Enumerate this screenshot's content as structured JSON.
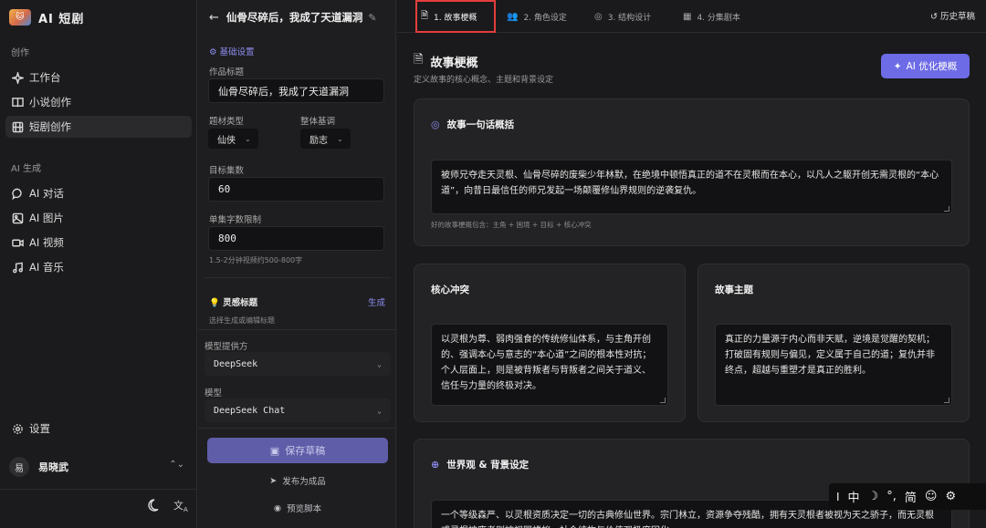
{
  "brand": {
    "logo_text": "🐱",
    "title": "AI 短剧"
  },
  "sidebar": {
    "section_create": "创作",
    "items_create": [
      {
        "label": "工作台",
        "icon": "sparkle-icon"
      },
      {
        "label": "小说创作",
        "icon": "book-icon"
      },
      {
        "label": "短剧创作",
        "icon": "film-icon",
        "active": true
      }
    ],
    "section_ai": "AI 生成",
    "items_ai": [
      {
        "label": "AI 对话",
        "icon": "chat-icon"
      },
      {
        "label": "AI 图片",
        "icon": "image-icon"
      },
      {
        "label": "AI 视频",
        "icon": "video-icon"
      },
      {
        "label": "AI 音乐",
        "icon": "music-icon"
      }
    ],
    "settings_label": "设置",
    "user": {
      "avatar_text": "易",
      "name": "易晓武"
    }
  },
  "panel": {
    "work_title": "仙骨尽碎后，我成了天道漏洞",
    "basic_settings": "基础设置",
    "title_label": "作品标题",
    "title_value": "仙骨尽碎后，我成了天道漏洞",
    "genre_label": "题材类型",
    "genre_value": "仙侠",
    "tone_label": "整体基调",
    "tone_value": "励志",
    "episodes_label": "目标集数",
    "episodes_value": "60",
    "wordlimit_label": "单集字数限制",
    "wordlimit_value": "800",
    "wordlimit_hint": "1.5-2分钟视频约500-800字",
    "inspire_label": "灵感标题",
    "inspire_action": "生成",
    "inspire_hint": "选择生成或编辑标题",
    "provider_label": "模型提供方",
    "provider_value": "DeepSeek",
    "model_label": "模型",
    "model_value": "DeepSeek Chat",
    "save_label": "保存草稿",
    "publish_label": "发布为成品",
    "preview_label": "预览脚本"
  },
  "tabs": [
    {
      "label": "1. 故事梗概",
      "icon": "doc-icon",
      "active": true
    },
    {
      "label": "2. 角色设定",
      "icon": "people-icon"
    },
    {
      "label": "3. 结构设计",
      "icon": "target-icon"
    },
    {
      "label": "4. 分集剧本",
      "icon": "film-icon"
    }
  ],
  "history_label": "历史草稿",
  "main": {
    "title": "故事梗概",
    "subtitle": "定义故事的核心概念、主题和背景设定",
    "ai_button": "AI 优化梗概",
    "logline_title": "故事一句话概括",
    "logline_text": "被师兄夺走天灵根、仙骨尽碎的废柴少年林默，在绝境中顿悟真正的道不在灵根而在本心，以凡人之躯开创无需灵根的“本心道”，向昔日最信任的师兄发起一场颠覆修仙界规则的逆袭复仇。",
    "logline_hint": "好的故事梗概包含：主角 + 困境 + 目标 + 核心冲突",
    "conflict_title": "核心冲突",
    "conflict_text": "以灵根为尊、弱肉强食的传统修仙体系，与主角开创的、强调本心与意志的“本心道”之间的根本性对抗；个人层面上，则是被背叛者与背叛者之间关于道义、信任与力量的终极对决。",
    "theme_title": "故事主题",
    "theme_text": "真正的力量源于内心而非天赋，逆境是觉醒的契机；打破固有规则与偏见，定义属于自己的道；复仇并非终点，超越与重塑才是真正的胜利。",
    "world_title": "世界观 & 背景设定",
    "world_text": "一个等级森严、以灵根资质决定一切的古典修仙世界。宗门林立，资源争夺残酷，拥有天灵根者被视为天之骄子，而无灵根或灵根被废者则被视同蝼蚁，社会结构与价值观极度固化。"
  },
  "ime": {
    "items": [
      "中",
      "☽",
      "°,",
      "简",
      "☺",
      "⚙"
    ]
  }
}
